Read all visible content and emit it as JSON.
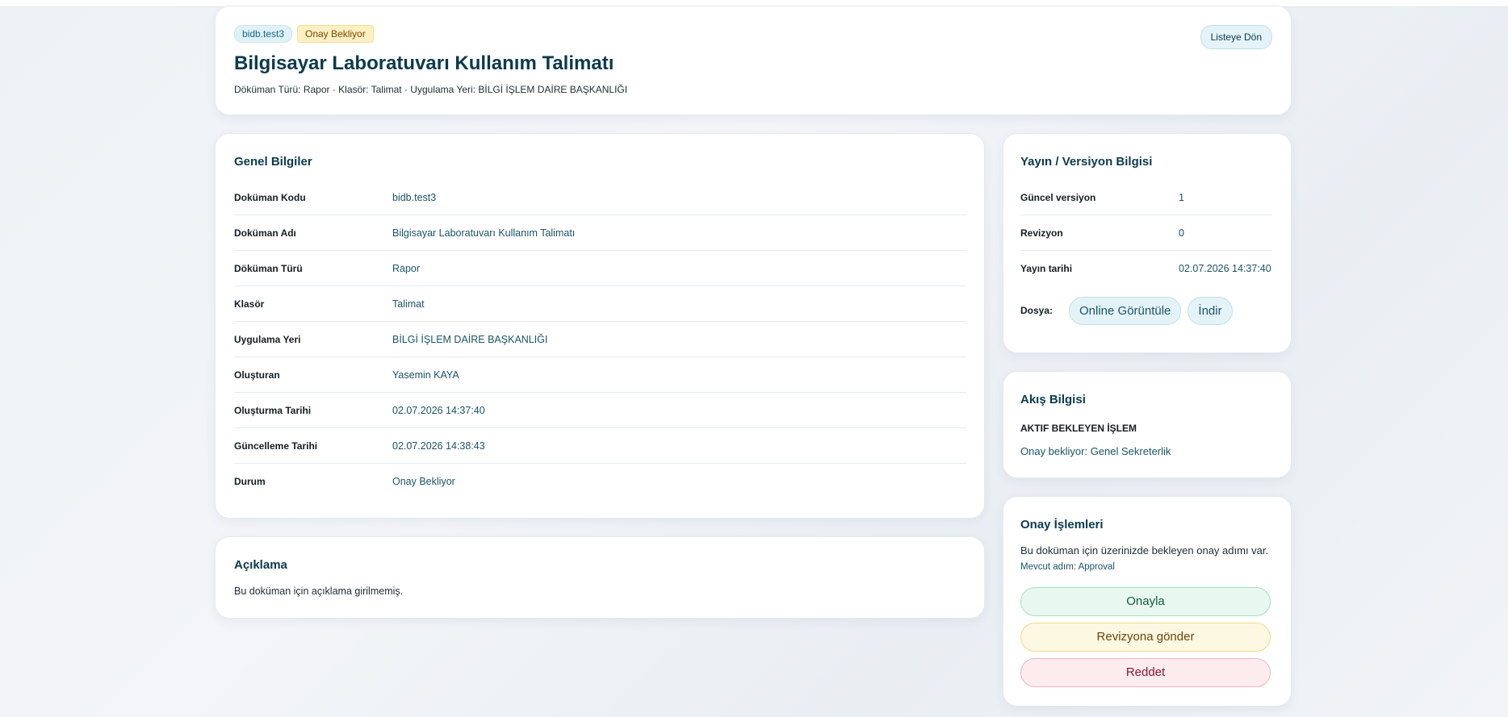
{
  "header": {
    "code_badge": "bidb.test3",
    "status_badge": "Onay Bekliyor",
    "back_label": "Listeye Dön",
    "title": "Bilgisayar Laboratuvarı Kullanım Talimatı",
    "meta": "Döküman Türü: Rapor · Klasör: Talimat · Uygulama Yeri: BİLGİ İŞLEM DAİRE BAŞKANLIĞI"
  },
  "general": {
    "title": "Genel Bilgiler",
    "rows": [
      {
        "label": "Doküman Kodu",
        "value": "bidb.test3"
      },
      {
        "label": "Doküman Adı",
        "value": "Bilgisayar Laboratuvarı Kullanım Talimatı"
      },
      {
        "label": "Döküman Türü",
        "value": "Rapor"
      },
      {
        "label": "Klasör",
        "value": "Talimat"
      },
      {
        "label": "Uygulama Yeri",
        "value": "BİLGİ İŞLEM DAİRE BAŞKANLIĞI"
      },
      {
        "label": "Oluşturan",
        "value": "Yasemin KAYA"
      },
      {
        "label": "Oluşturma Tarihi",
        "value": "02.07.2026 14:37:40"
      },
      {
        "label": "Güncelleme Tarihi",
        "value": "02.07.2026 14:38:43"
      },
      {
        "label": "Durum",
        "value": "Onay Bekliyor"
      }
    ]
  },
  "description": {
    "title": "Açıklama",
    "text": "Bu doküman için açıklama girilmemiş."
  },
  "version": {
    "title": "Yayın / Versiyon Bilgisi",
    "rows": [
      {
        "label": "Güncel versiyon",
        "value": "1"
      },
      {
        "label": "Revizyon",
        "value": "0"
      },
      {
        "label": "Yayın tarihi",
        "value": "02.07.2026 14:37:40"
      }
    ],
    "file_label": "Dosya:",
    "view_label": "Online Görüntüle",
    "download_label": "İndir"
  },
  "flow": {
    "title": "Akış Bilgisi",
    "subtitle": "AKTIF BEKLEYEN İŞLEM",
    "text": "Onay bekliyor: Genel Sekreterlik"
  },
  "approval": {
    "title": "Onay İşlemleri",
    "text": "Bu doküman için üzerinizde bekleyen onay adımı var.",
    "step": "Mevcut adım: Approval",
    "approve_label": "Onayla",
    "revise_label": "Revizyona gönder",
    "reject_label": "Reddet"
  }
}
